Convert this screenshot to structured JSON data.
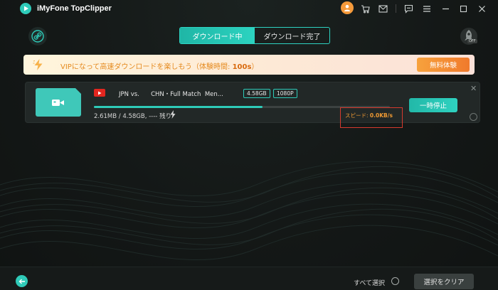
{
  "window": {
    "title": "iMyFone TopClipper"
  },
  "titlebar_icons": [
    "avatar-icon",
    "cart-icon",
    "mail-icon",
    "chat-icon",
    "menu-icon",
    "minimize-icon",
    "maximize-icon",
    "close-icon"
  ],
  "tabs": [
    {
      "label": "ダウンロード中",
      "active": true
    },
    {
      "label": "ダウンロード完了",
      "active": false
    }
  ],
  "vip_banner": {
    "text": "VIPになって高速ダウンロードを楽しもう（体験時間: ",
    "time": "100s",
    "close_paren": "）",
    "button_label": "無料体験"
  },
  "speed_badge": {
    "label": "OFF"
  },
  "task": {
    "title": "JPN vs.      CHN・Full Match  Men...",
    "size_tag": "4.58GB",
    "quality_tag": "1080P",
    "progress": 0.57,
    "size_text": "2.61MB / 4.58GB, ---- 残り",
    "speed_label": "スピード: ",
    "speed_value": "0.0KB/s",
    "pause_label": "一時停止"
  },
  "footer": {
    "select_all_label": "すべて選択",
    "clear_label": "選択をクリア"
  },
  "colors": {
    "accent": "#2ecbb9",
    "vip_orange": "#f07a2c",
    "highlight_red": "#d63a2e",
    "background": "#131716"
  }
}
